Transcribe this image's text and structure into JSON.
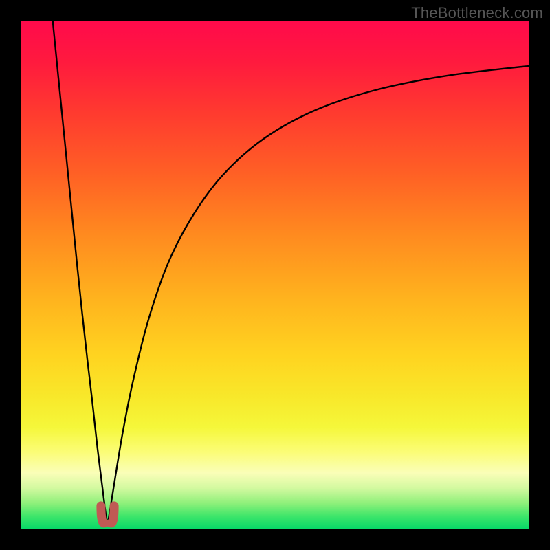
{
  "watermark": {
    "text": "TheBottleneck.com"
  },
  "colors": {
    "black": "#000000",
    "marker": "#c05a54",
    "gradient_stops": [
      {
        "offset": 0.0,
        "color": "#ff0a4b"
      },
      {
        "offset": 0.08,
        "color": "#ff1a3e"
      },
      {
        "offset": 0.18,
        "color": "#ff3a2f"
      },
      {
        "offset": 0.3,
        "color": "#ff6025"
      },
      {
        "offset": 0.42,
        "color": "#ff8a1f"
      },
      {
        "offset": 0.55,
        "color": "#ffb41e"
      },
      {
        "offset": 0.66,
        "color": "#ffd420"
      },
      {
        "offset": 0.74,
        "color": "#f8e82a"
      },
      {
        "offset": 0.8,
        "color": "#f5f73a"
      },
      {
        "offset": 0.85,
        "color": "#fbfd78"
      },
      {
        "offset": 0.89,
        "color": "#fafeb8"
      },
      {
        "offset": 0.92,
        "color": "#d3f9a0"
      },
      {
        "offset": 0.95,
        "color": "#8ef07a"
      },
      {
        "offset": 0.975,
        "color": "#3fe66a"
      },
      {
        "offset": 1.0,
        "color": "#07d968"
      }
    ]
  },
  "chart_data": {
    "type": "line",
    "title": "",
    "xlabel": "",
    "ylabel": "",
    "xlim": [
      0,
      100
    ],
    "ylim": [
      0,
      100
    ],
    "grid": false,
    "legend": false,
    "curve_minimum_x": 17,
    "markers": [
      {
        "x": 15.7,
        "y": 2.5
      },
      {
        "x": 18.3,
        "y": 2.5
      }
    ],
    "left_branch": [
      {
        "x": 6.2,
        "y": 100.0
      },
      {
        "x": 7.0,
        "y": 92.0
      },
      {
        "x": 8.0,
        "y": 82.0
      },
      {
        "x": 9.0,
        "y": 72.0
      },
      {
        "x": 10.0,
        "y": 62.0
      },
      {
        "x": 11.0,
        "y": 52.0
      },
      {
        "x": 12.0,
        "y": 42.5
      },
      {
        "x": 13.0,
        "y": 33.5
      },
      {
        "x": 14.0,
        "y": 25.0
      },
      {
        "x": 15.0,
        "y": 16.0
      },
      {
        "x": 16.0,
        "y": 8.0
      },
      {
        "x": 16.7,
        "y": 2.5
      },
      {
        "x": 17.0,
        "y": 1.0
      }
    ],
    "right_branch": [
      {
        "x": 17.0,
        "y": 1.0
      },
      {
        "x": 17.3,
        "y": 2.5
      },
      {
        "x": 18.5,
        "y": 10.0
      },
      {
        "x": 20.0,
        "y": 19.0
      },
      {
        "x": 22.0,
        "y": 29.0
      },
      {
        "x": 25.0,
        "y": 41.0
      },
      {
        "x": 29.0,
        "y": 52.5
      },
      {
        "x": 34.0,
        "y": 62.0
      },
      {
        "x": 40.0,
        "y": 70.0
      },
      {
        "x": 48.0,
        "y": 77.0
      },
      {
        "x": 58.0,
        "y": 82.5
      },
      {
        "x": 70.0,
        "y": 86.5
      },
      {
        "x": 84.0,
        "y": 89.3
      },
      {
        "x": 100.0,
        "y": 91.2
      }
    ]
  }
}
